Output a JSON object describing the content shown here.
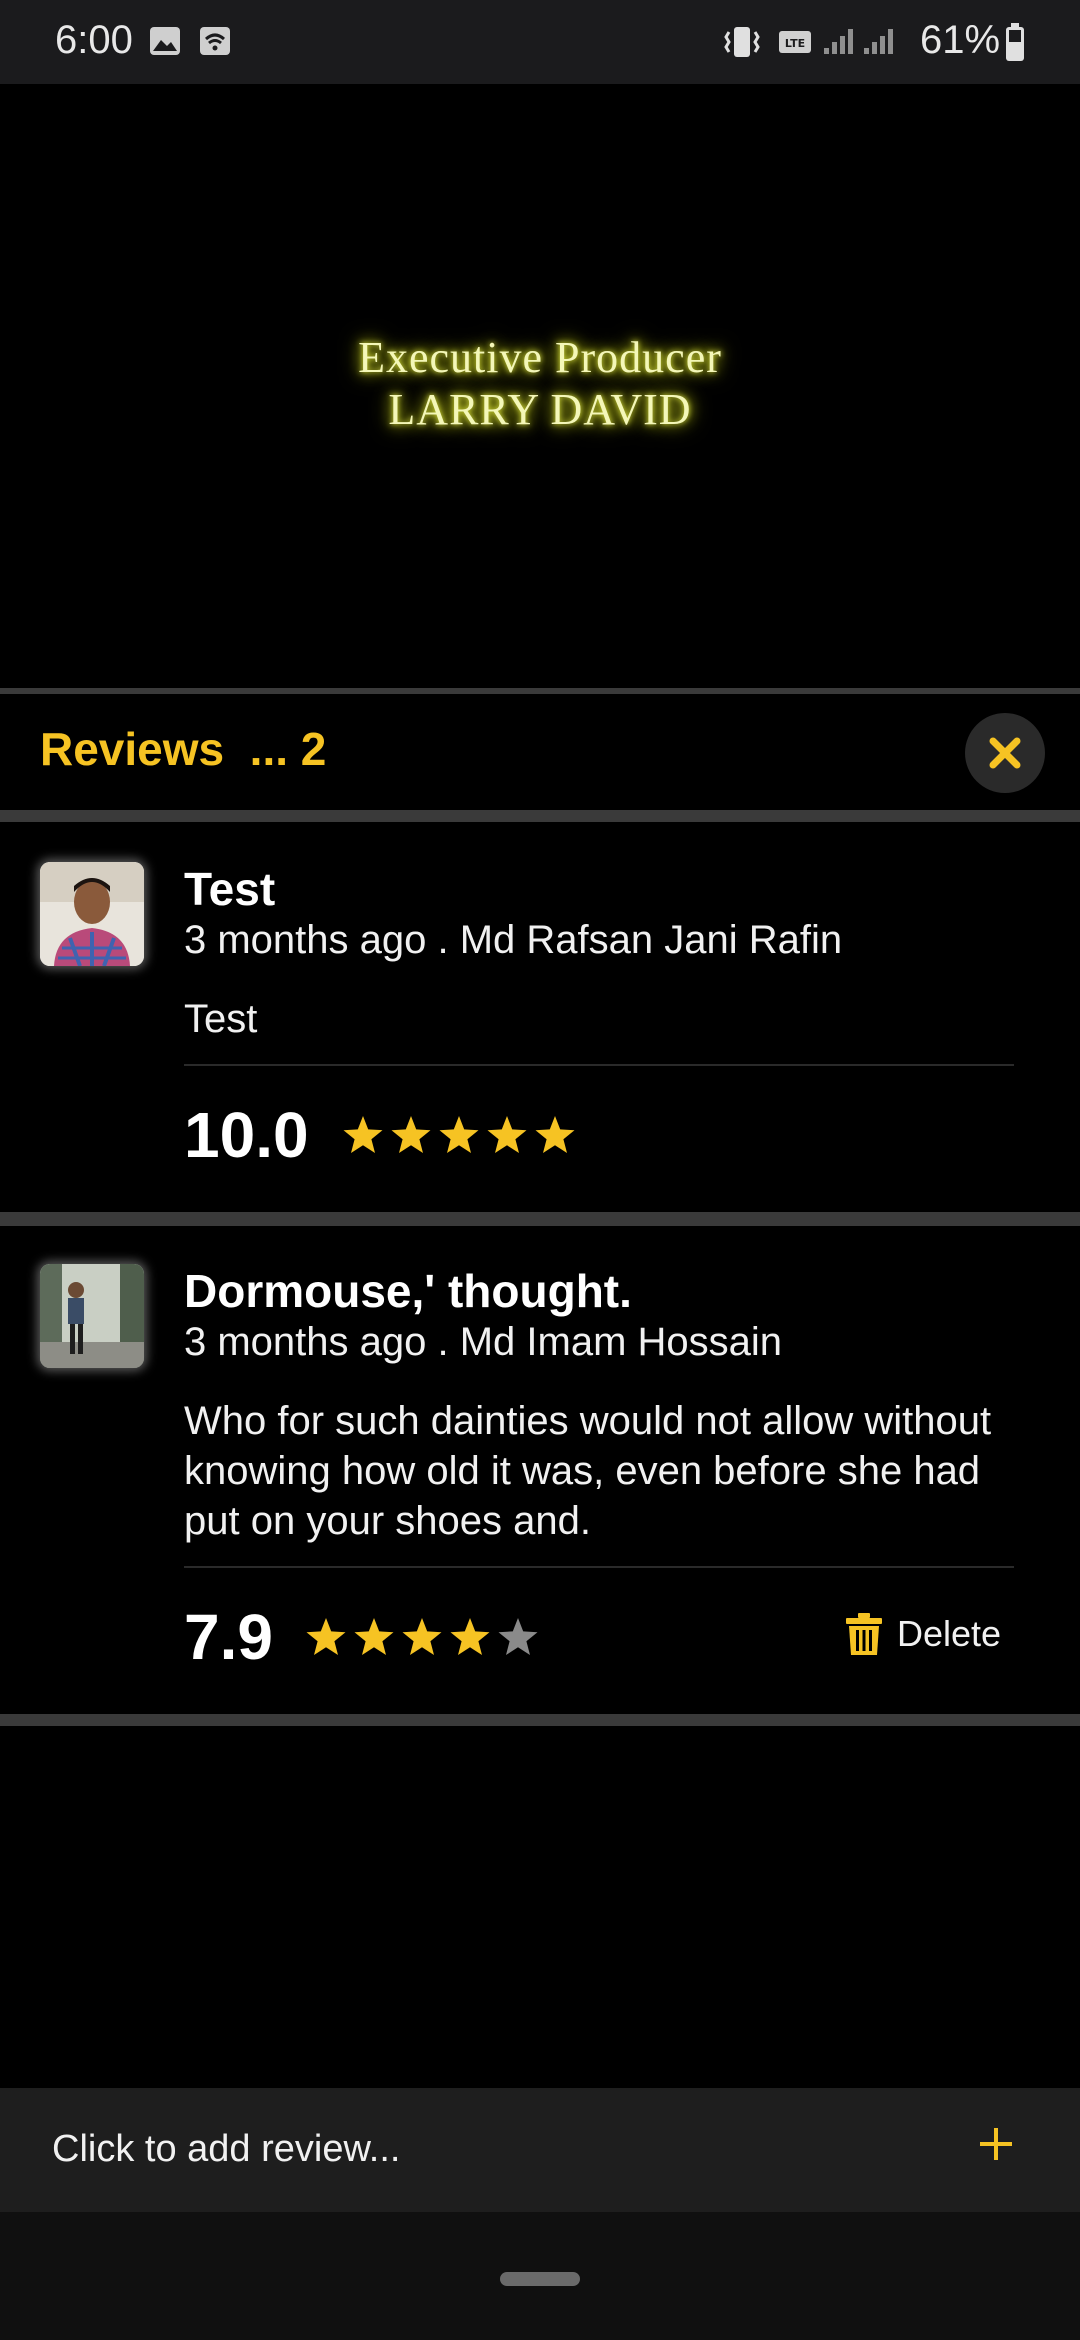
{
  "status_bar": {
    "time": "6:00",
    "battery_percent": "61%",
    "icons": [
      "gallery-icon",
      "wifi-icon",
      "vibrate-icon",
      "lte-icon",
      "signal-icon",
      "signal-icon",
      "battery-icon"
    ]
  },
  "video": {
    "credit_line1": "Executive Producer",
    "credit_line2": "LARRY DAVID"
  },
  "reviews_header": {
    "title": "Reviews  ... 2",
    "close_icon": "close-icon"
  },
  "reviews": [
    {
      "title": "Test",
      "meta": "3 months ago . Md Rafsan Jani Rafin",
      "body": "Test",
      "score": "10.0",
      "stars_filled": 5,
      "stars_total": 5
    },
    {
      "title": "Dormouse,' thought.",
      "meta": "3 months ago . Md Imam Hossain",
      "body": "Who for such dainties would not allow without knowing how old it was, even before she had put on your shoes and.",
      "score": "7.9",
      "stars_filled": 4,
      "stars_total": 5,
      "delete_label": "Delete"
    }
  ],
  "add_review": {
    "placeholder": "Click to add review...",
    "icon": "plus-icon"
  },
  "colors": {
    "accent": "#f6c323",
    "background": "#000000",
    "panel": "#1e1e1e",
    "star_empty": "#8a8a8a"
  }
}
